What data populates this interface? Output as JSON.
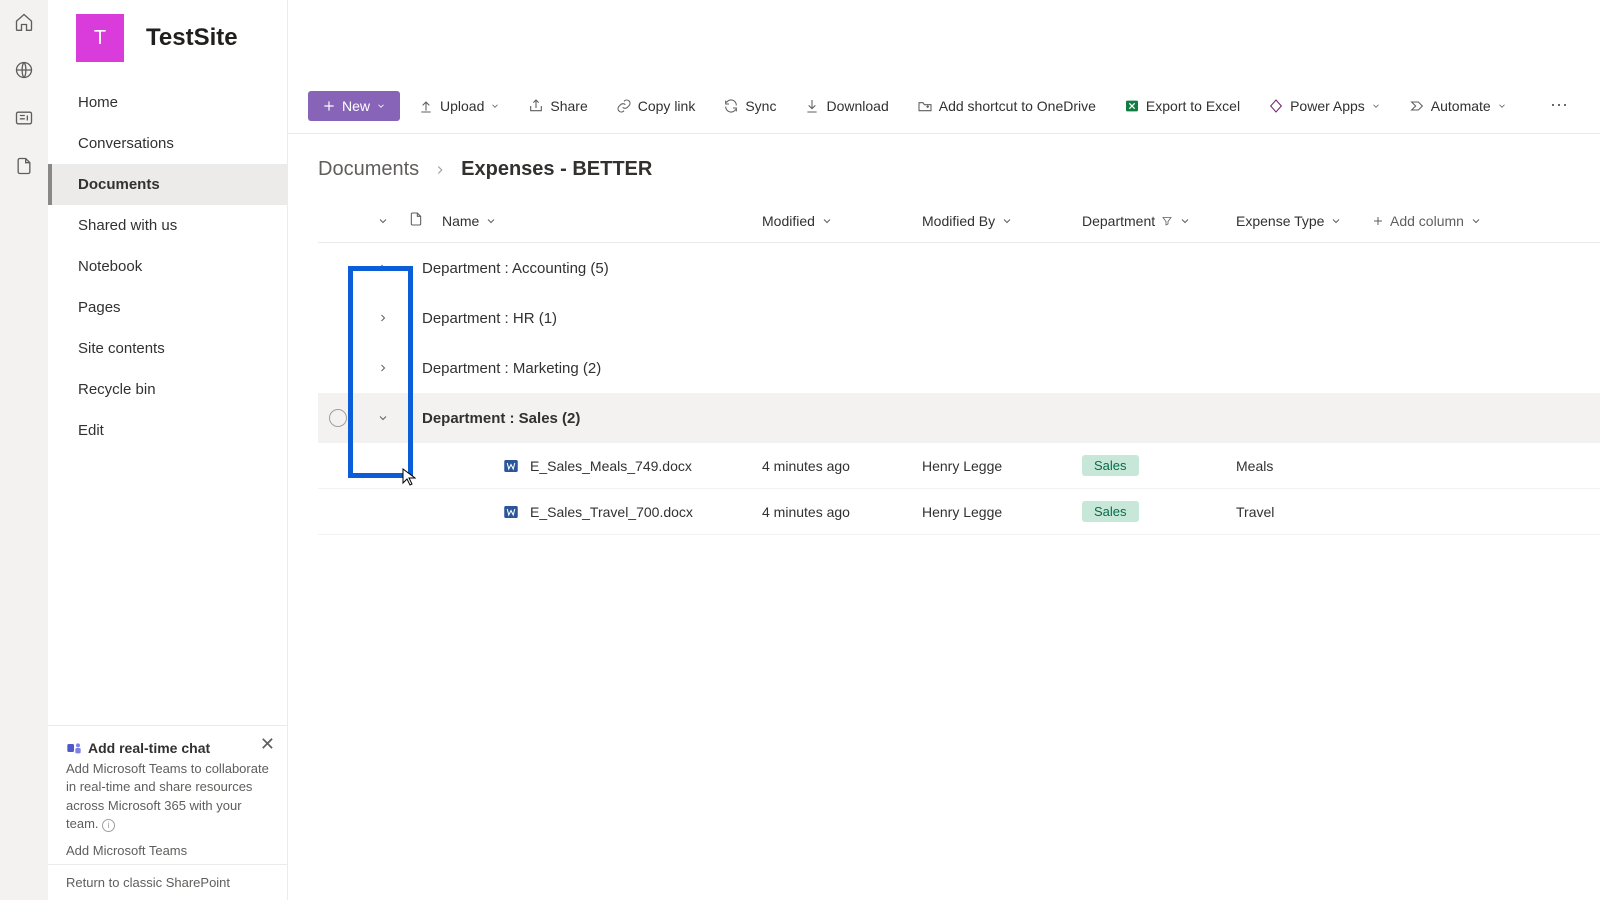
{
  "site": {
    "logo_letter": "T",
    "title": "TestSite"
  },
  "nav": {
    "items": [
      {
        "label": "Home"
      },
      {
        "label": "Conversations"
      },
      {
        "label": "Documents"
      },
      {
        "label": "Shared with us"
      },
      {
        "label": "Notebook"
      },
      {
        "label": "Pages"
      },
      {
        "label": "Site contents"
      },
      {
        "label": "Recycle bin"
      },
      {
        "label": "Edit"
      }
    ],
    "active_index": 2
  },
  "promo": {
    "title": "Add real-time chat",
    "body": "Add Microsoft Teams to collaborate in real-time and share resources across Microsoft 365 with your team.",
    "link": "Add Microsoft Teams"
  },
  "classic_link": "Return to classic SharePoint",
  "commands": {
    "new": "New",
    "upload": "Upload",
    "share": "Share",
    "copy_link": "Copy link",
    "sync": "Sync",
    "download": "Download",
    "shortcut": "Add shortcut to OneDrive",
    "export": "Export to Excel",
    "powerapps": "Power Apps",
    "automate": "Automate"
  },
  "breadcrumb": {
    "root": "Documents",
    "current": "Expenses - BETTER"
  },
  "columns": {
    "name": "Name",
    "modified": "Modified",
    "modified_by": "Modified By",
    "department": "Department",
    "expense_type": "Expense Type",
    "add_column": "Add column"
  },
  "groups": [
    {
      "label": "Department : Accounting (5)",
      "expanded": false
    },
    {
      "label": "Department : HR (1)",
      "expanded": false
    },
    {
      "label": "Department : Marketing (2)",
      "expanded": false
    },
    {
      "label": "Department : Sales (2)",
      "expanded": true
    }
  ],
  "items": [
    {
      "name": "E_Sales_Meals_749.docx",
      "modified": "4 minutes ago",
      "by": "Henry Legge",
      "dept": "Sales",
      "exptype": "Meals"
    },
    {
      "name": "E_Sales_Travel_700.docx",
      "modified": "4 minutes ago",
      "by": "Henry Legge",
      "dept": "Sales",
      "exptype": "Travel"
    }
  ]
}
